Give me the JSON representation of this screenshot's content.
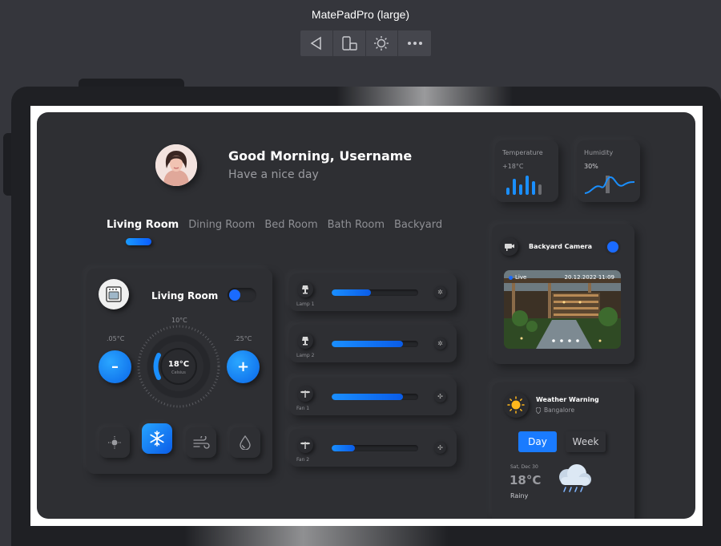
{
  "emulator": {
    "title": "MatePadPro (large)",
    "toolbar": [
      {
        "icon": "back-triangle-icon"
      },
      {
        "icon": "rotate-device-icon"
      },
      {
        "icon": "brightness-icon"
      },
      {
        "icon": "more-icon"
      }
    ]
  },
  "header": {
    "greeting": "Good Morning, Username",
    "subtitle": "Have a nice day"
  },
  "rooms": {
    "tabs": [
      "Living Room",
      "Dining Room",
      "Bed Room",
      "Bath Room",
      "Backyard"
    ],
    "active": 0
  },
  "living_room": {
    "title": "Living Room",
    "power_on": true,
    "min_label": ".05°C",
    "top_label": "10°C",
    "max_label": ".25°C",
    "current_temp": "18°C",
    "temp_unit": "Celsius",
    "minus_label": "–",
    "plus_label": "+",
    "modes": [
      {
        "icon": "sun-icon",
        "active": false
      },
      {
        "icon": "snowflake-icon",
        "active": true
      },
      {
        "icon": "wind-icon",
        "active": false
      },
      {
        "icon": "water-drop-icon",
        "active": false
      }
    ]
  },
  "devices": [
    {
      "label": "Lamp 1",
      "icon": "lamp-icon",
      "level": 0.45
    },
    {
      "label": "Lamp 2",
      "icon": "lamp-icon",
      "level": 0.82
    },
    {
      "label": "Fan 1",
      "icon": "fan-icon",
      "level": 0.82
    },
    {
      "label": "Fan 2",
      "icon": "fan-icon",
      "level": 0.27
    }
  ],
  "stats": {
    "temperature": {
      "title": "Temperature",
      "value": "+18°C"
    },
    "humidity": {
      "title": "Humidity",
      "value": "30%"
    }
  },
  "camera": {
    "title": "Backyard Camera",
    "enabled": true,
    "live_label": "Live",
    "timestamp": "20.12.2022 11:09"
  },
  "weather": {
    "title": "Weather Warning",
    "location": "Bangalore",
    "tabs": [
      "Day",
      "Week"
    ],
    "active_tab": 0,
    "date": "Sat, Dec 30",
    "temp": "18°C",
    "condition": "Rainy"
  },
  "colors": {
    "accent": "#1a6bff",
    "accent_light": "#27a4ff",
    "panel": "#2e2f33",
    "background": "#35363c"
  }
}
